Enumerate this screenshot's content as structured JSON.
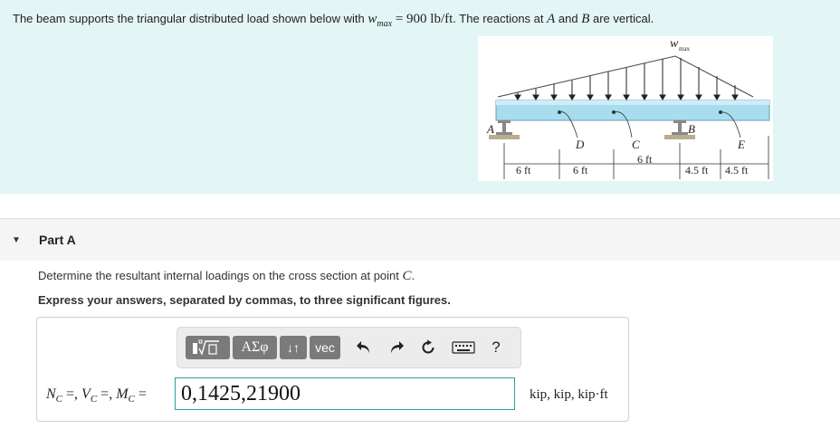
{
  "problem": {
    "text_part1": "The beam supports the triangular distributed load shown below with ",
    "wmax_symbol": "w",
    "wmax_subscript": "max",
    "wmax_value": " = 900 lb/ft",
    "text_part2": ". The reactions at ",
    "point_a": "A",
    "text_part3": " and ",
    "point_b": "B",
    "text_part4": " are vertical."
  },
  "figure": {
    "load_label": "w",
    "load_subscript": "max",
    "labels": {
      "A": "A",
      "B": "B",
      "C": "C",
      "D": "D",
      "E": "E"
    },
    "dimensions": [
      "6 ft",
      "6 ft",
      "6 ft",
      "4.5 ft",
      "4.5 ft"
    ]
  },
  "part": {
    "title": "Part A",
    "question_prefix": "Determine the resultant internal loadings on the cross section at point ",
    "question_point": "C",
    "question_suffix": ".",
    "instruction": "Express your answers, separated by commas, to three significant figures."
  },
  "toolbar": {
    "greek_label": "ΑΣφ",
    "arrows_label": "↓↑",
    "vec_label": "vec",
    "help_label": "?"
  },
  "answer": {
    "label": "N",
    "label_full": "NC =, VC =, MC =",
    "value": "0,1425,21900",
    "units": "kip, kip, kip·ft"
  },
  "colors": {
    "problem_bg": "#e3f5f4",
    "beam": "#a8dcef",
    "input_border": "#2f9e9a",
    "toolbar_button": "#7a7a7a"
  }
}
